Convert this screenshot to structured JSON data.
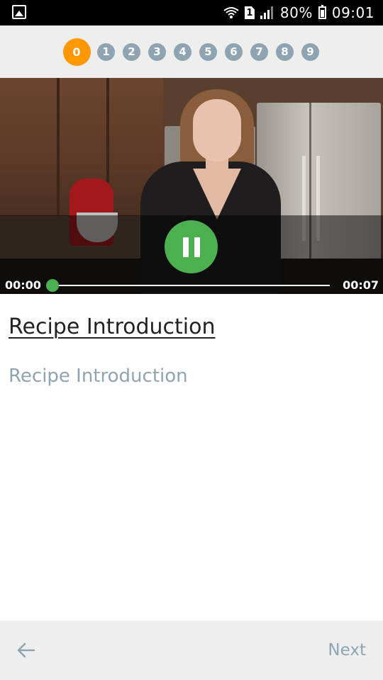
{
  "status_bar": {
    "battery_percent": "80%",
    "time": "09:01",
    "sim_label": "1"
  },
  "steps": {
    "items": [
      "0",
      "1",
      "2",
      "3",
      "4",
      "5",
      "6",
      "7",
      "8",
      "9"
    ],
    "active_index": 0
  },
  "video": {
    "current_time": "00:00",
    "total_time": "00:07",
    "progress": 0.0
  },
  "content": {
    "title": "Recipe Introduction",
    "description": "Recipe Introduction"
  },
  "nav": {
    "next_label": "Next"
  },
  "colors": {
    "active_step": "#ff9800",
    "inactive_step": "#8fa4b3",
    "accent_green": "#4caf50",
    "muted_text": "#8fa4b3"
  }
}
